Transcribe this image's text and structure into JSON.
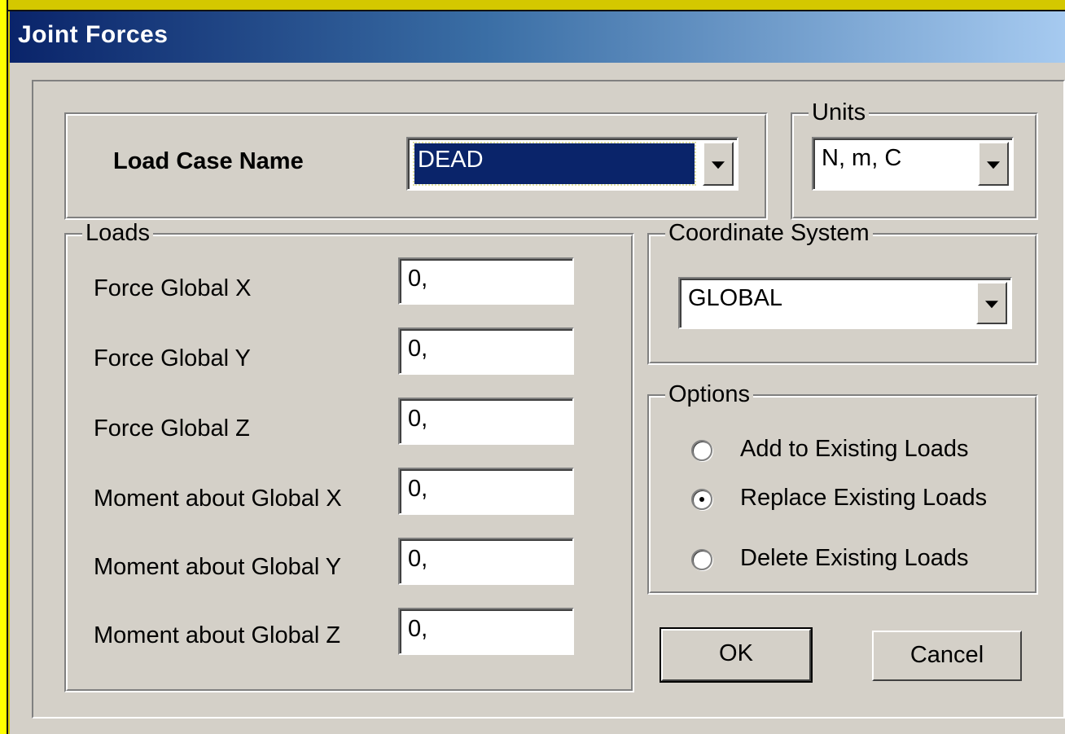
{
  "window": {
    "title": "Joint Forces"
  },
  "load_case": {
    "label": "Load Case Name",
    "value": "DEAD"
  },
  "units": {
    "legend": "Units",
    "value": "N, m, C"
  },
  "loads": {
    "legend": "Loads",
    "rows": [
      {
        "label": "Force Global X",
        "value": "0,"
      },
      {
        "label": "Force Global Y",
        "value": "0,"
      },
      {
        "label": "Force Global Z",
        "value": "0,"
      },
      {
        "label": "Moment about Global X",
        "value": "0,"
      },
      {
        "label": "Moment about Global Y",
        "value": "0,"
      },
      {
        "label": "Moment about Global Z",
        "value": "0,"
      }
    ]
  },
  "coordinate_system": {
    "legend": "Coordinate System",
    "value": "GLOBAL"
  },
  "options": {
    "legend": "Options",
    "items": [
      {
        "label": "Add to Existing Loads",
        "selected": false
      },
      {
        "label": "Replace Existing Loads",
        "selected": true
      },
      {
        "label": "Delete Existing Loads",
        "selected": false
      }
    ]
  },
  "buttons": {
    "ok": "OK",
    "cancel": "Cancel"
  }
}
